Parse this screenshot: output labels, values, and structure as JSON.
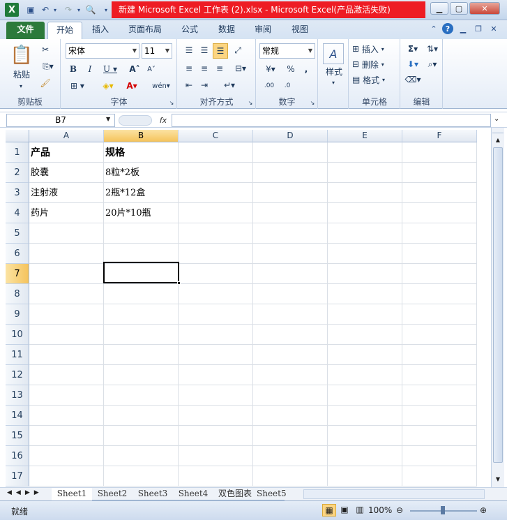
{
  "title": "新建 Microsoft Excel 工作表 (2).xlsx  -  Microsoft Excel(产品激活失败)",
  "tabs": [
    "文件",
    "开始",
    "插入",
    "页面布局",
    "公式",
    "数据",
    "审阅",
    "视图"
  ],
  "ribbon": {
    "clipboard": {
      "label": "剪贴板",
      "paste": "粘贴"
    },
    "font": {
      "label": "字体",
      "name": "宋体",
      "size": "11"
    },
    "alignment": {
      "label": "对齐方式"
    },
    "number": {
      "label": "数字",
      "format": "常规"
    },
    "styles": {
      "label": "样式"
    },
    "cells": {
      "label": "单元格",
      "insert": "插入",
      "delete": "删除",
      "format": "格式"
    },
    "editing": {
      "label": "编辑"
    }
  },
  "formula": {
    "namebox": "B7",
    "fx": "fx",
    "value": ""
  },
  "columns": [
    "A",
    "B",
    "C",
    "D",
    "E",
    "F"
  ],
  "selected_col": "B",
  "selected_row": "7",
  "rows": [
    {
      "n": "1",
      "a": "产品",
      "b": "规格"
    },
    {
      "n": "2",
      "a": "胶囊",
      "b": "8粒*2板"
    },
    {
      "n": "3",
      "a": "注射液",
      "b": "2瓶*12盒"
    },
    {
      "n": "4",
      "a": "药片",
      "b": "20片*10瓶"
    },
    {
      "n": "5",
      "a": "",
      "b": ""
    },
    {
      "n": "6",
      "a": "",
      "b": ""
    },
    {
      "n": "7",
      "a": "",
      "b": ""
    },
    {
      "n": "8",
      "a": "",
      "b": ""
    },
    {
      "n": "9",
      "a": "",
      "b": ""
    },
    {
      "n": "10",
      "a": "",
      "b": ""
    },
    {
      "n": "11",
      "a": "",
      "b": ""
    },
    {
      "n": "12",
      "a": "",
      "b": ""
    },
    {
      "n": "13",
      "a": "",
      "b": ""
    },
    {
      "n": "14",
      "a": "",
      "b": ""
    },
    {
      "n": "15",
      "a": "",
      "b": ""
    },
    {
      "n": "16",
      "a": "",
      "b": ""
    },
    {
      "n": "17",
      "a": "",
      "b": ""
    }
  ],
  "sheets": [
    "Sheet1",
    "Sheet2",
    "Sheet3",
    "Sheet4",
    "双色图表",
    "Sheet5"
  ],
  "status": {
    "ready": "就绪",
    "zoom": "100%"
  },
  "colors": {
    "file_tab": "#2c7a3b",
    "title_highlight": "#ee1c24",
    "selection": "#f5c35b"
  }
}
